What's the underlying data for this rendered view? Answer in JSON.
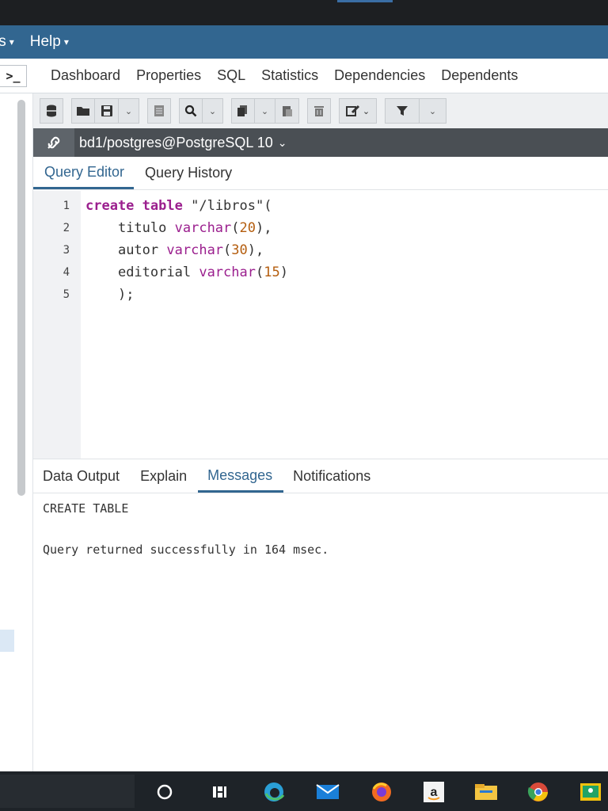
{
  "menubar": {
    "items": [
      {
        "label": "ls",
        "icon": "chevron-down-icon"
      },
      {
        "label": "Help",
        "icon": "chevron-down-icon"
      }
    ]
  },
  "main_tabs": {
    "terminal_icon": ">_",
    "tabs": [
      "Dashboard",
      "Properties",
      "SQL",
      "Statistics",
      "Dependencies",
      "Dependents"
    ]
  },
  "toolbar": {
    "icons": [
      "database-icon",
      "open-folder-icon",
      "save-icon",
      "chevron-down-icon",
      "edit-icon",
      "search-icon",
      "chevron-down-icon",
      "copy-icon",
      "chevron-down-icon",
      "paste-icon",
      "delete-icon",
      "edit-pencil-icon",
      "filter-icon",
      "chevron-down-icon"
    ]
  },
  "connection": {
    "label": "bd1/postgres@PostgreSQL 10",
    "caret": "⌄"
  },
  "query_tabs": [
    "Query Editor",
    "Query History"
  ],
  "editor": {
    "line_numbers": [
      "1",
      "2",
      "3",
      "4",
      "5"
    ],
    "lines": [
      {
        "kw1": "create",
        "kw2": "table",
        "text": "\"/libros\"("
      },
      {
        "indent": "    ",
        "name": "titulo",
        "type": "varchar",
        "open": "(",
        "num": "20",
        "close": "),"
      },
      {
        "indent": "    ",
        "name": "autor",
        "type": "varchar",
        "open": "(",
        "num": "30",
        "close": "),"
      },
      {
        "indent": "    ",
        "name": "editorial",
        "type": "varchar",
        "open": "(",
        "num": "15",
        "close": ")"
      },
      {
        "indent": "    ",
        "text": ");"
      }
    ]
  },
  "result_tabs": [
    "Data Output",
    "Explain",
    "Messages",
    "Notifications"
  ],
  "messages": {
    "line1": "CREATE TABLE",
    "line2": "Query returned successfully in 164 msec."
  },
  "taskbar": {
    "icons": [
      "cortana-icon",
      "task-view-icon",
      "edge-icon",
      "mail-icon",
      "firefox-icon",
      "amazon-icon",
      "file-explorer-icon",
      "chrome-icon",
      "classroom-icon"
    ]
  },
  "colors": {
    "menubar": "#326690",
    "accent": "#326690",
    "connbar": "#4a4f54",
    "keyword": "#9b1f8e",
    "number": "#b45d0e"
  }
}
